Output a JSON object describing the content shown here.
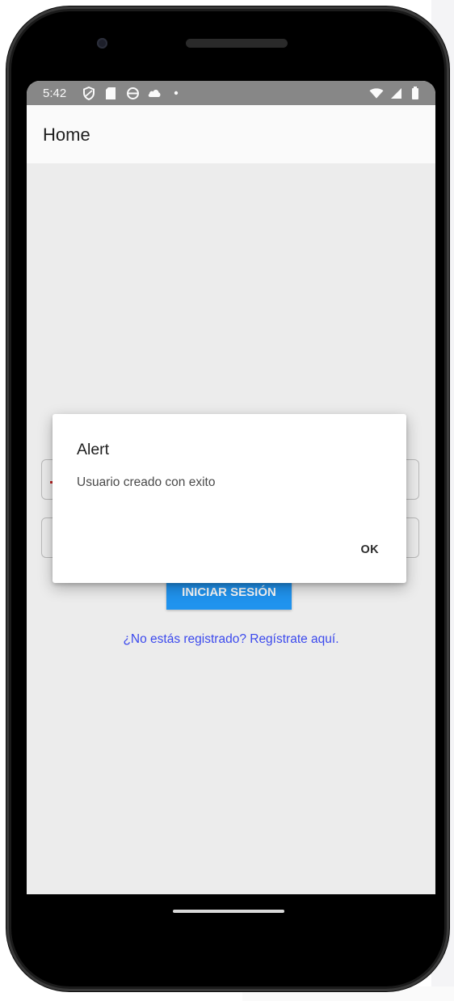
{
  "status_bar": {
    "time": "5:42",
    "left_icons": [
      "shield-icon",
      "sim-card-icon",
      "circle-sync-icon",
      "cloud-icon",
      "dot-icon"
    ],
    "right_icons": [
      "wifi-icon",
      "signal-icon",
      "battery-icon"
    ]
  },
  "app_bar": {
    "title": "Home"
  },
  "login": {
    "button_label": "INICIAR SESIÓN",
    "register_link": "¿No estás registrado? Regístrate aquí."
  },
  "dialog": {
    "title": "Alert",
    "message": "Usuario creado con exito",
    "ok_label": "OK"
  },
  "colors": {
    "primary_button": "#2196f3",
    "link": "#3d4bf2",
    "status_bar": "#8a8a8a",
    "screen_background": "#f1f1f1"
  }
}
